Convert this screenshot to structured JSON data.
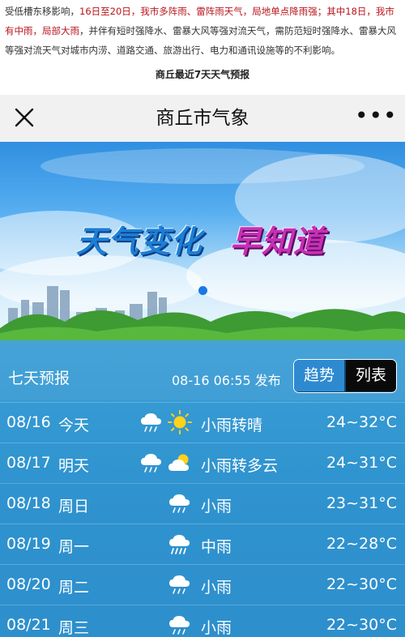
{
  "article": {
    "p1": "受低槽东移影响，",
    "p2": "16日至20日，我市多阵雨、雷阵雨天气，局地单点降雨强；其中18日，我市有中雨，局部大雨",
    "p3": "，并伴有短时强降水、雷暴大风等强对流天气，需防范短时强降水、雷暴大风等强对流天气对城市内涝、道路交通、旅游出行、电力和通讯设施等的不利影响。",
    "caption": "商丘最近7天天气预报"
  },
  "navbar": {
    "title": "商丘市气象",
    "close_icon": "close-icon",
    "more_icon": "more-icon",
    "more_label": "•••"
  },
  "banner": {
    "slogan_a": "天气变化",
    "slogan_b": "早知道"
  },
  "forecast": {
    "title": "七天预报",
    "issued": "08-16 06:55 发布",
    "view_trend": "趋势",
    "view_list": "列表",
    "active_view": "列表",
    "days": [
      {
        "date": "08/16",
        "day": "今天",
        "cond": "小雨转晴",
        "temp": "24~32°C",
        "icons": [
          "light-rain-icon",
          "sunny-icon"
        ]
      },
      {
        "date": "08/17",
        "day": "明天",
        "cond": "小雨转多云",
        "temp": "24~31°C",
        "icons": [
          "light-rain-icon",
          "partly-cloudy-icon"
        ]
      },
      {
        "date": "08/18",
        "day": "周日",
        "cond": "小雨",
        "temp": "23~31°C",
        "icons": [
          "light-rain-icon"
        ]
      },
      {
        "date": "08/19",
        "day": "周一",
        "cond": "中雨",
        "temp": "22~28°C",
        "icons": [
          "moderate-rain-icon"
        ]
      },
      {
        "date": "08/20",
        "day": "周二",
        "cond": "小雨",
        "temp": "22~30°C",
        "icons": [
          "light-rain-icon"
        ]
      },
      {
        "date": "08/21",
        "day": "周三",
        "cond": "小雨",
        "temp": "22~30°C",
        "icons": [
          "light-rain-icon"
        ]
      }
    ]
  },
  "colors": {
    "accent_red": "#b8141c",
    "forecast_bg": "#2f93cf",
    "toggle_active": "#0a0a0a",
    "carousel_dot": "#1978e6"
  }
}
